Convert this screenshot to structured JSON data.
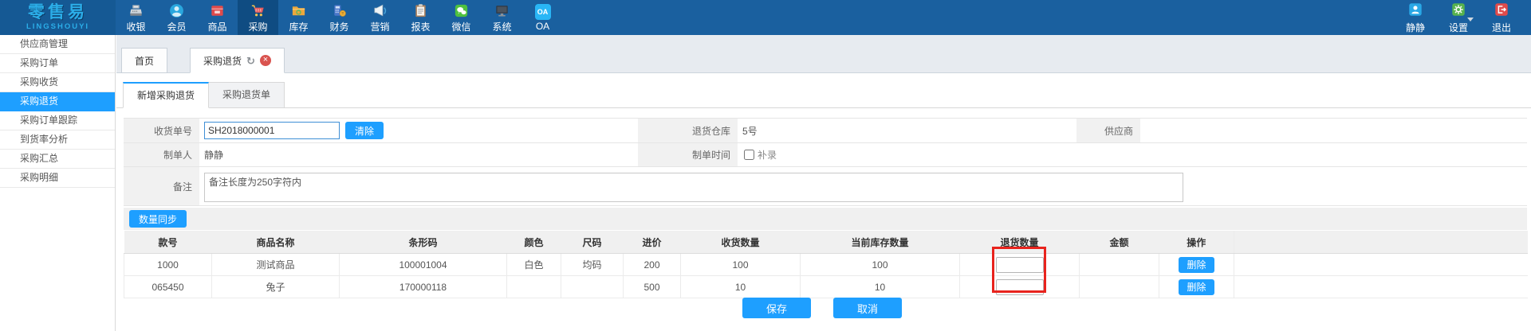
{
  "topbar": {
    "logo": {
      "title": "零售易",
      "subtitle": "LINGSHOUYI"
    },
    "oa_icon_text": "OA",
    "menu": [
      {
        "label": "收银",
        "icon": "cash-register-icon",
        "active": false
      },
      {
        "label": "会员",
        "icon": "member-icon",
        "active": false
      },
      {
        "label": "商品",
        "icon": "goods-icon",
        "active": false
      },
      {
        "label": "采购",
        "icon": "cart-icon",
        "active": true
      },
      {
        "label": "库存",
        "icon": "inventory-icon",
        "active": false
      },
      {
        "label": "财务",
        "icon": "finance-icon",
        "active": false
      },
      {
        "label": "营销",
        "icon": "marketing-icon",
        "active": false
      },
      {
        "label": "报表",
        "icon": "report-icon",
        "active": false
      },
      {
        "label": "微信",
        "icon": "wechat-icon",
        "active": false
      },
      {
        "label": "系统",
        "icon": "system-icon",
        "active": false
      },
      {
        "label": "OA",
        "icon": "oa-icon",
        "active": false
      }
    ],
    "user": {
      "name": "静静"
    },
    "settings": {
      "label": "设置"
    },
    "logout": {
      "label": "退出"
    }
  },
  "sidebar": {
    "items": [
      {
        "label": "供应商管理",
        "active": false
      },
      {
        "label": "采购订单",
        "active": false
      },
      {
        "label": "采购收货",
        "active": false
      },
      {
        "label": "采购退货",
        "active": true
      },
      {
        "label": "采购订单跟踪",
        "active": false
      },
      {
        "label": "到货率分析",
        "active": false
      },
      {
        "label": "采购汇总",
        "active": false
      },
      {
        "label": "采购明细",
        "active": false
      }
    ]
  },
  "tabs": [
    {
      "label": "首页",
      "active": false
    },
    {
      "label": "采购退货",
      "active": true,
      "icons": [
        "refresh-icon",
        "close-icon"
      ]
    }
  ],
  "subtabs": [
    {
      "label": "新增采购退货",
      "active": true
    },
    {
      "label": "采购退货单",
      "active": false
    }
  ],
  "form": {
    "receipt_no": {
      "label": "收货单号",
      "value": "SH2018000001",
      "clear_label": "清除"
    },
    "warehouse": {
      "label": "退货仓库",
      "value": "5号"
    },
    "supplier": {
      "label": "供应商",
      "value": ""
    },
    "creator": {
      "label": "制单人",
      "value": "静静"
    },
    "create_time": {
      "label": "制单时间",
      "checkbox_label": "补录",
      "checked": false
    },
    "remark": {
      "label": "备注",
      "value": "备注长度为250字符内"
    }
  },
  "toolbar": {
    "sync_label": "数量同步"
  },
  "table": {
    "headers": [
      "款号",
      "商品名称",
      "条形码",
      "颜色",
      "尺码",
      "进价",
      "收货数量",
      "当前库存数量",
      "退货数量",
      "金额",
      "操作"
    ],
    "rows": [
      {
        "style_no": "1000",
        "name": "测试商品",
        "barcode": "100001004",
        "color": "白色",
        "size": "均码",
        "price": "200",
        "received": "100",
        "stock": "100",
        "return_qty": "",
        "amount": "",
        "action": "删除"
      },
      {
        "style_no": "065450",
        "name": "兔子",
        "barcode": "170000118",
        "color": "",
        "size": "",
        "price": "500",
        "received": "10",
        "stock": "10",
        "return_qty": "",
        "amount": "",
        "action": "删除"
      }
    ]
  },
  "footer": {
    "save_label": "保存",
    "cancel_label": "取消"
  },
  "colors": {
    "accent": "#1e9fff",
    "topbar": "#1a609f",
    "topbar_active": "#0f4c82",
    "highlight_box": "#e8231d",
    "sidebar_active": "#1e9fff"
  }
}
